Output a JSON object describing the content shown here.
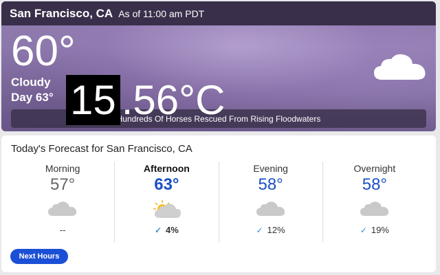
{
  "hero": {
    "location": "San Francisco, CA",
    "as_of": "As of 11:00 am PDT",
    "temperature": "60°",
    "condition": "Cloudy",
    "day_info": "Day 63°",
    "condition_icon": "cloud-icon",
    "headline": "Hundreds Of Horses Rescued From Rising Floodwaters"
  },
  "overlay": {
    "whole": "15",
    "rest": ".56°C"
  },
  "forecast": {
    "title": "Today's Forecast for San Francisco, CA",
    "periods": [
      {
        "name": "Morning",
        "temp": "57°",
        "icon": "cloud-icon",
        "precip": "--"
      },
      {
        "name": "Afternoon",
        "temp": "63°",
        "icon": "partly-cloudy-icon",
        "precip": "4%"
      },
      {
        "name": "Evening",
        "temp": "58°",
        "icon": "cloud-icon",
        "precip": "12%"
      },
      {
        "name": "Overnight",
        "temp": "58°",
        "icon": "cloud-icon",
        "precip": "19%"
      }
    ],
    "next_hours_label": "Next Hours"
  },
  "colors": {
    "accent": "#1b4fd6",
    "temp_blue": "#1b4fc4",
    "topbar": "#3a2f4a"
  }
}
